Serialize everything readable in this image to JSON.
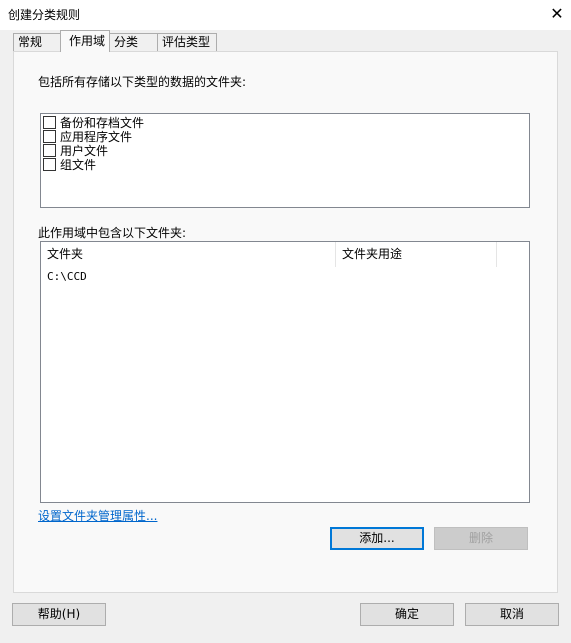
{
  "window": {
    "title": "创建分类规则",
    "close_glyph": "✕"
  },
  "tabs": [
    {
      "label": "常规"
    },
    {
      "label": "作用域"
    },
    {
      "label": "分类"
    },
    {
      "label": "评估类型"
    }
  ],
  "scope": {
    "types_label": "包括所有存储以下类型的数据的文件夹:",
    "checkboxes": [
      {
        "label": "备份和存档文件",
        "checked": false
      },
      {
        "label": "应用程序文件",
        "checked": false
      },
      {
        "label": "用户文件",
        "checked": false
      },
      {
        "label": "组文件",
        "checked": false
      }
    ],
    "folders_label": "此作用域中包含以下文件夹:",
    "columns": [
      "文件夹",
      "文件夹用途"
    ],
    "rows": [
      {
        "folder": "C:\\CCD",
        "usage": ""
      }
    ],
    "link": "设置文件夹管理属性...",
    "add_button": "添加...",
    "remove_button": "删除"
  },
  "footer": {
    "help_button": "帮助(H)",
    "ok_button": "确定",
    "cancel_button": "取消"
  }
}
